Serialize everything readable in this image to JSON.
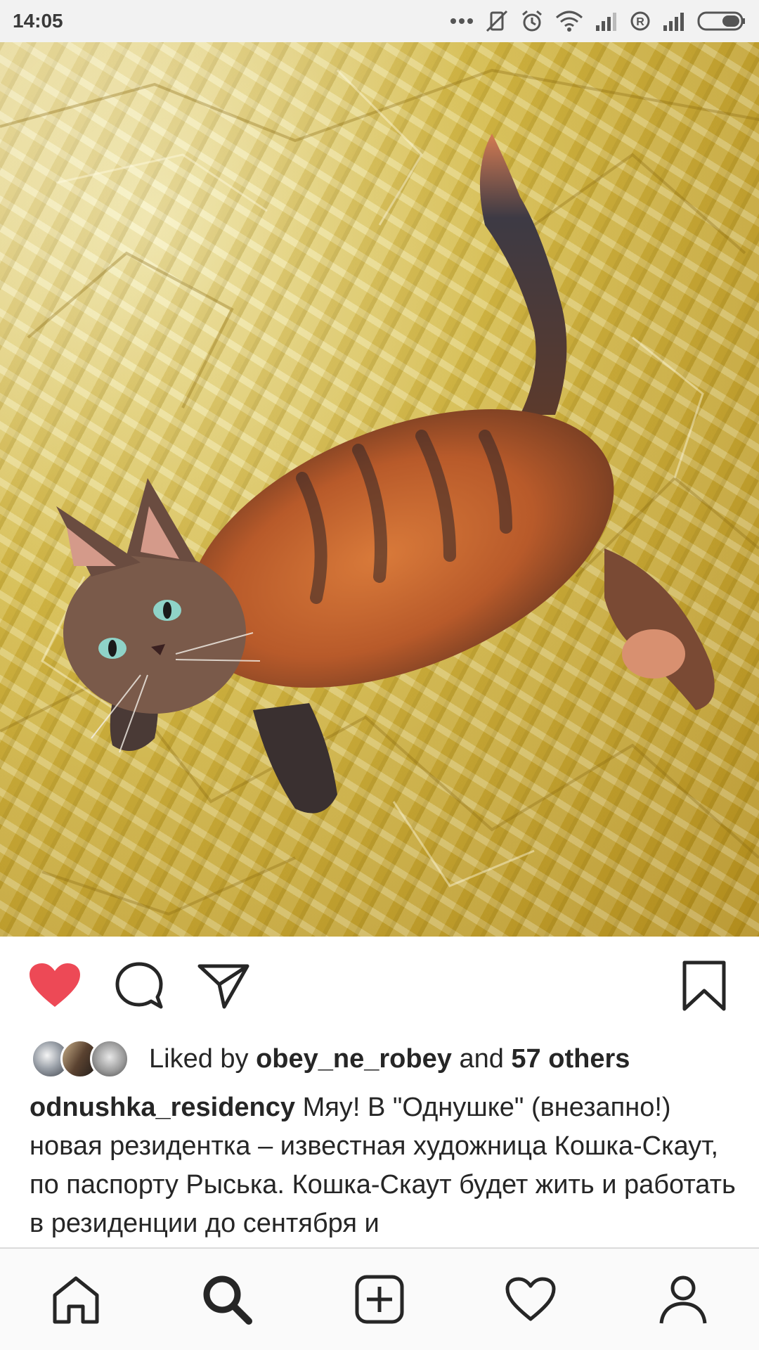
{
  "status_bar": {
    "time": "14:05",
    "icons": [
      "more-dots-icon",
      "vibrate-off-icon",
      "alarm-icon",
      "wifi-icon",
      "signal-icon",
      "roaming-icon",
      "signal-icon",
      "battery-icon"
    ]
  },
  "post": {
    "image_alt": "tortoiseshell cat on gold foil",
    "actions": [
      "like-filled-icon",
      "comment-icon",
      "share-icon",
      "bookmark-icon"
    ],
    "liked": true,
    "likes": {
      "prefix": "Liked by ",
      "user": "obey_ne_robey",
      "middle": " and ",
      "others": "57 others"
    },
    "caption": {
      "username": "odnushka_residency",
      "text": " Мяу! В \"Однушке\" (внезапно!) новая резидентка – известная художница Кошка-Скаут, по паспорту Рыська. Кошка-Скаут будет жить и работать в резиденции до сентября и"
    }
  },
  "bottom_nav": {
    "items": [
      "home-icon",
      "search-icon",
      "new-post-icon",
      "activity-heart-icon",
      "profile-icon"
    ],
    "active": "search-icon"
  },
  "colors": {
    "like_red": "#ed4956",
    "text": "#262626",
    "status_bg": "#f2f2f2",
    "nav_bg": "#fafafa"
  }
}
